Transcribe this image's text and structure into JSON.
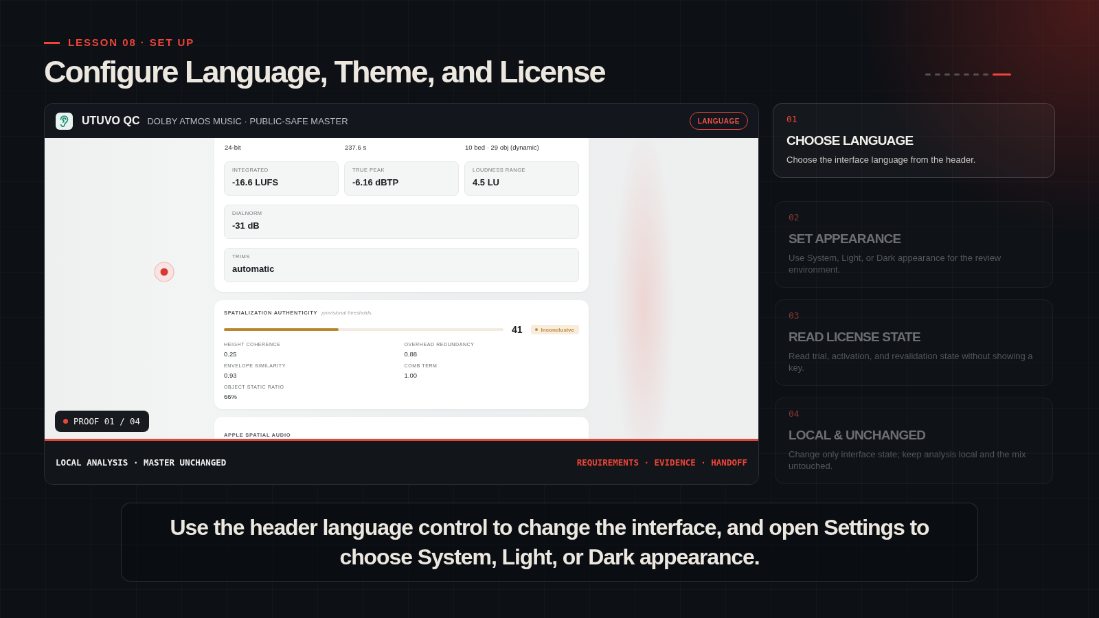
{
  "lesson": {
    "eyebrow": "LESSON 08 · SET UP",
    "title": "Configure Language, Theme, and License"
  },
  "progress": [
    {
      "selected": false
    },
    {
      "selected": false
    },
    {
      "selected": false
    },
    {
      "selected": false
    },
    {
      "selected": false
    },
    {
      "selected": false
    },
    {
      "selected": false
    },
    {
      "selected": true
    }
  ],
  "app_window": {
    "name": "UTUVO QC",
    "subtitle": "DOLBY ATMOS MUSIC · PUBLIC-SAFE MASTER",
    "language_button": "LANGUAGE",
    "summary_values": [
      "24-bit",
      "237.6 s",
      "10 bed · 29 obj (dynamic)"
    ],
    "loudness_metrics": [
      {
        "label": "INTEGRATED",
        "value": "-16.6 LUFS"
      },
      {
        "label": "TRUE PEAK",
        "value": "-6.16 dBTP"
      },
      {
        "label": "LOUDNESS RANGE",
        "value": "4.5 LU"
      }
    ],
    "fields": [
      {
        "label": "DIALNORM",
        "value": "-31 dB"
      },
      {
        "label": "TRIMS",
        "value": "automatic"
      }
    ],
    "spatialization": {
      "title": "SPATIALIZATION AUTHENTICITY",
      "note": "provisional thresholds",
      "level": 0.41,
      "score": "41",
      "verdict": "Inconclusive",
      "measures": [
        {
          "label": "HEIGHT COHERENCE",
          "value": "0.25"
        },
        {
          "label": "OVERHEAD REDUNDANCY",
          "value": "0.88"
        },
        {
          "label": "ENVELOPE SIMILARITY",
          "value": "0.93"
        },
        {
          "label": "COMB TERM",
          "value": "1.00"
        },
        {
          "label": "OBJECT STATIC RATIO",
          "value": "66%"
        }
      ]
    },
    "next_section": "APPLE SPATIAL AUDIO",
    "proof_badge": "PROOF 01 / 04",
    "footer": {
      "left": "LOCAL ANALYSIS · MASTER UNCHANGED",
      "right": "REQUIREMENTS · EVIDENCE · HANDOFF"
    }
  },
  "steps": [
    {
      "number": "01",
      "title": "CHOOSE LANGUAGE",
      "description": "Choose the interface language from the header.",
      "selected": true
    },
    {
      "number": "02",
      "title": "SET APPEARANCE",
      "description": "Use System, Light, or Dark appearance for the review environment.",
      "selected": false
    },
    {
      "number": "03",
      "title": "READ LICENSE STATE",
      "description": "Read trial, activation, and revalidation state without showing a key.",
      "selected": false
    },
    {
      "number": "04",
      "title": "LOCAL & UNCHANGED",
      "description": "Change only interface state; keep analysis local and the mix untouched.",
      "selected": false
    }
  ],
  "caption": "Use the header language control to change the interface, and open Settings to choose System, Light, or Dark appearance."
}
